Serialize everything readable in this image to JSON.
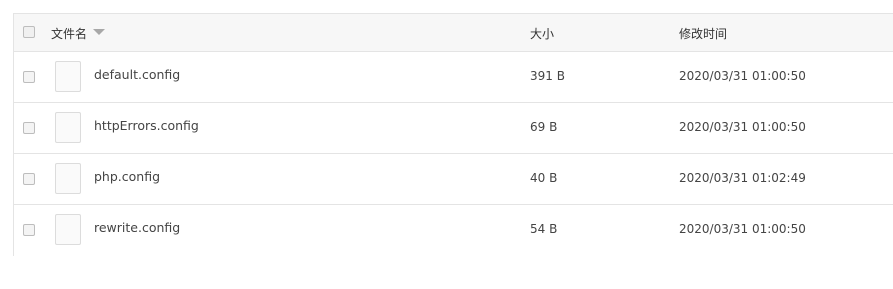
{
  "header": {
    "name_label": "文件名",
    "size_label": "大小",
    "time_label": "修改时间",
    "sort_icon": "sort-desc-triangle-icon"
  },
  "files": [
    {
      "icon": "file-icon",
      "name": "default.config",
      "size": "391 B",
      "modified": "2020/03/31 01:00:50"
    },
    {
      "icon": "file-icon",
      "name": "httpErrors.config",
      "size": "69 B",
      "modified": "2020/03/31 01:00:50"
    },
    {
      "icon": "file-icon",
      "name": "php.config",
      "size": "40 B",
      "modified": "2020/03/31 01:02:49"
    },
    {
      "icon": "file-icon",
      "name": "rewrite.config",
      "size": "54 B",
      "modified": "2020/03/31 01:00:50"
    }
  ],
  "colors": {
    "header_bg": "#f7f7f7",
    "border": "#e4e4e4",
    "text": "#333333",
    "sort_icon": "#a8a8a8"
  }
}
